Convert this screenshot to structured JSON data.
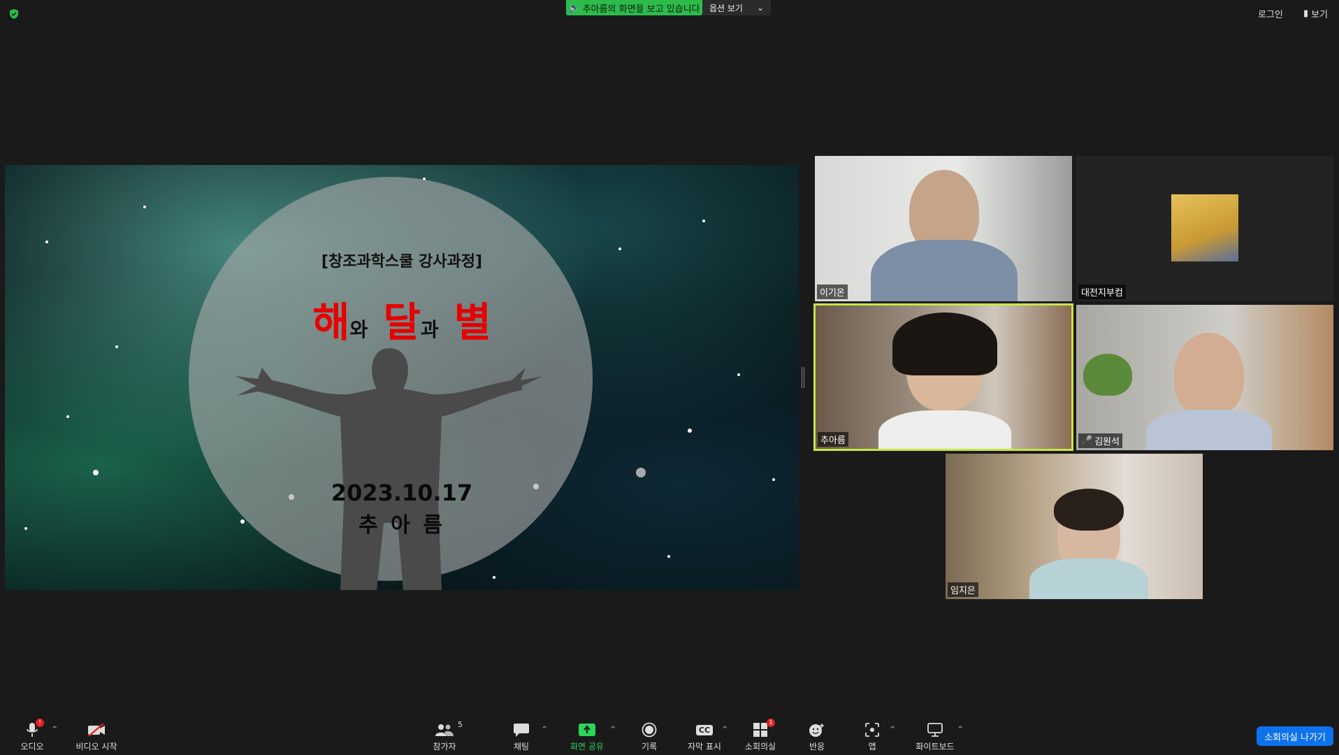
{
  "top_bar": {
    "share_banner": "추아름의 화면을 보고 있습니다",
    "view_options": "옵션 보기",
    "login": "로그인",
    "view": "보기"
  },
  "slide": {
    "subtitle": "[창조과학스쿨 강사과정]",
    "title_parts": [
      "해",
      "와",
      "달",
      "과",
      "별"
    ],
    "date": "2023.10.17",
    "presenter": "추 아 름"
  },
  "participants": [
    {
      "name": "이기온"
    },
    {
      "name": "대전지부컴"
    },
    {
      "name": "추아름"
    },
    {
      "name": "김원석"
    },
    {
      "name": "임지은"
    }
  ],
  "toolbar": {
    "audio": "오디오",
    "audio_badge": "!",
    "video": "비디오 시작",
    "participants": "참가자",
    "participants_count": "5",
    "chat": "채팅",
    "share": "화면 공유",
    "record": "기록",
    "captions": "자막 표시",
    "captions_icon": "CC",
    "breakout": "소회의실",
    "breakout_badge": "1",
    "reactions": "반응",
    "apps": "앱",
    "whiteboard": "화이트보드",
    "leave": "소회의실 나가기"
  },
  "colors": {
    "share_green": "#2dbb4a",
    "active_speaker": "#c9e642",
    "leave_blue": "#0e72ed",
    "title_red": "#e60000"
  }
}
